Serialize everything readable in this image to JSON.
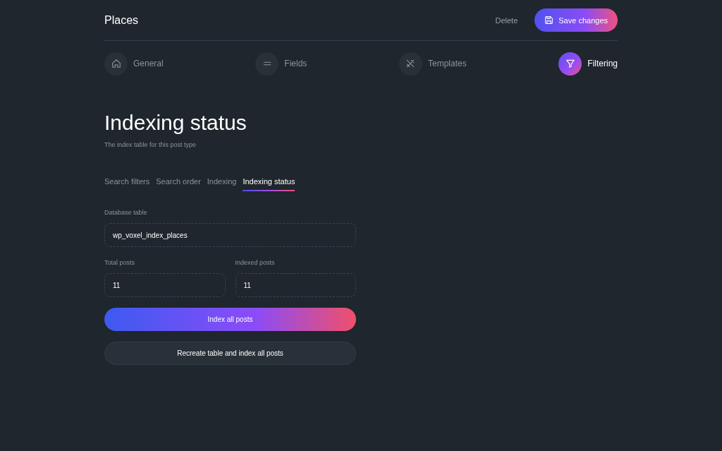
{
  "header": {
    "title": "Places",
    "delete": "Delete",
    "save": "Save changes"
  },
  "steps": [
    {
      "label": "General",
      "selected": false
    },
    {
      "label": "Fields",
      "selected": false
    },
    {
      "label": "Templates",
      "selected": false
    },
    {
      "label": "Filtering",
      "selected": true
    }
  ],
  "heading": "Indexing status",
  "subtitle": "The index table for this post type",
  "tabs": [
    {
      "label": "Search filters",
      "selected": false
    },
    {
      "label": "Search order",
      "selected": false
    },
    {
      "label": "Indexing",
      "selected": false
    },
    {
      "label": "Indexing status",
      "selected": true
    }
  ],
  "database_table": {
    "label": "Database table",
    "value": "wp_voxel_index_places"
  },
  "total_posts": {
    "label": "Total posts",
    "value": "11"
  },
  "indexed_posts": {
    "label": "Indexed posts",
    "value": "11"
  },
  "buttons": [
    {
      "label": "Index all posts",
      "kind": "primary"
    },
    {
      "label": "Recreate table and index all posts",
      "kind": "secondary"
    }
  ]
}
